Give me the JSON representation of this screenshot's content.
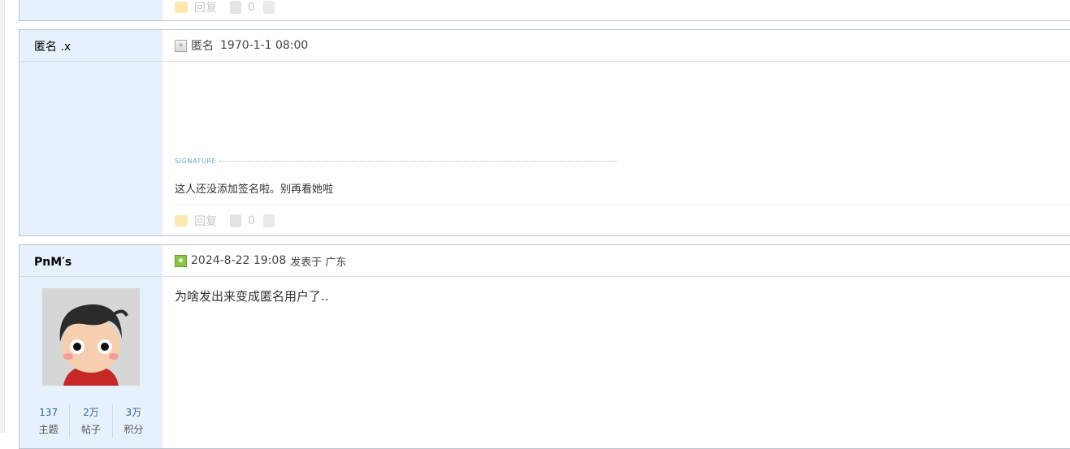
{
  "prev_post": {
    "actions": {
      "reply_label": "回复",
      "like_count": "0"
    }
  },
  "anon_post": {
    "username": "匿名 .x",
    "author": "匿名",
    "date": "1970-1-1 08:00",
    "signature_label": "SIGNATURE",
    "signature_text": "这人还没添加签名啦。别再看她啦",
    "actions": {
      "reply_label": "回复",
      "like_count": "0"
    }
  },
  "user_post": {
    "username": "PnM′s",
    "date": "2024-8-22 19:08",
    "location_label": "发表于 广东",
    "content": "为啥发出来变成匿名用户了..",
    "stats": [
      {
        "value": "137",
        "label": "主题"
      },
      {
        "value": "2万",
        "label": "帖子"
      },
      {
        "value": "3万",
        "label": "积分"
      }
    ]
  }
}
